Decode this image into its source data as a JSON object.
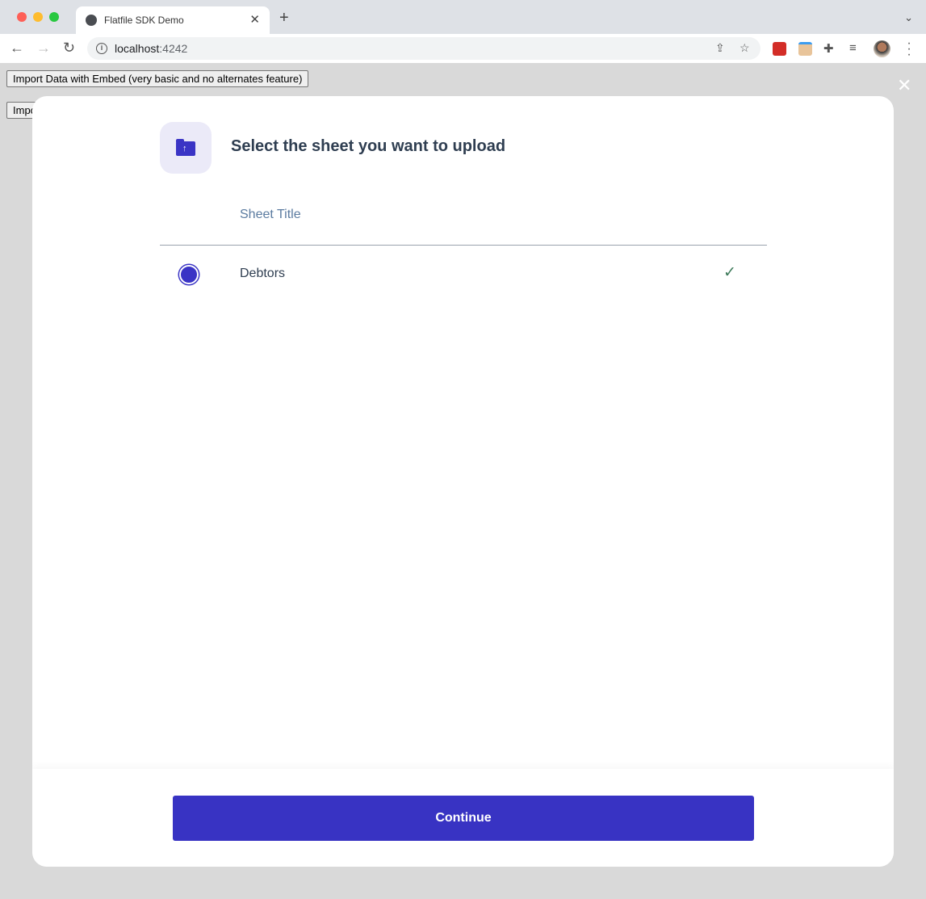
{
  "browser": {
    "tab_title": "Flatfile SDK Demo",
    "url_host": "localhost",
    "url_port": ":4242"
  },
  "page": {
    "button1": "Import Data with Embed (very basic and no alternates feature)",
    "button2": "Import"
  },
  "modal": {
    "title": "Select the sheet you want to upload",
    "column_header": "Sheet Title",
    "rows": [
      {
        "label": "Debtors",
        "selected": true,
        "valid": true
      }
    ],
    "continue_label": "Continue"
  },
  "colors": {
    "accent": "#3833c3"
  }
}
